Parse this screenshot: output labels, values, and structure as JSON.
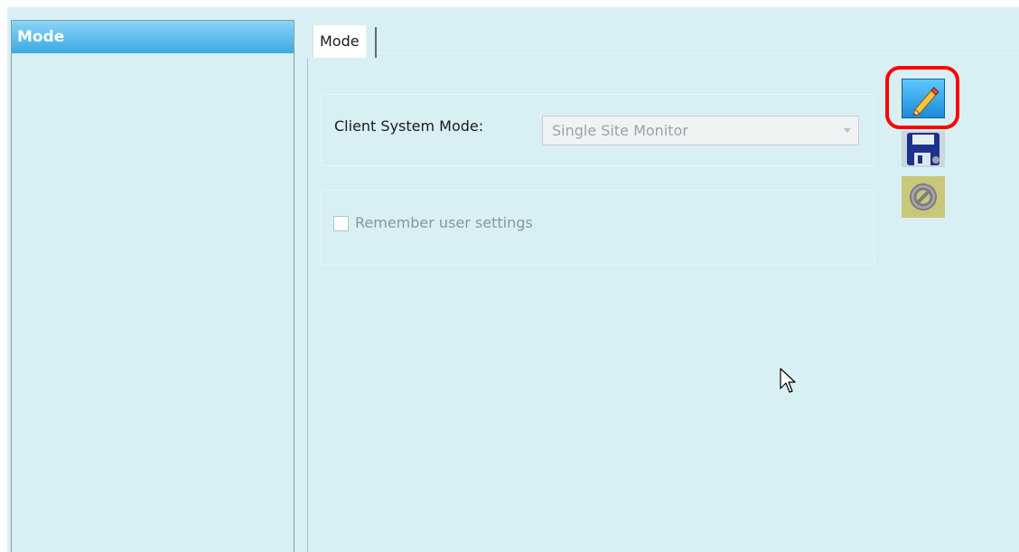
{
  "nav": {
    "items": [
      {
        "label": "Mode",
        "selected": true
      }
    ]
  },
  "tabs": [
    {
      "label": "Mode",
      "active": true
    }
  ],
  "client_system_mode": {
    "label": "Client System Mode:",
    "value": "Single Site Monitor",
    "disabled": true
  },
  "remember_settings": {
    "label": "Remember user settings",
    "checked": false,
    "disabled": true
  },
  "actions": {
    "edit": {
      "icon": "pencil-icon",
      "highlighted": true
    },
    "save": {
      "icon": "floppy-disk-icon"
    },
    "cancel": {
      "icon": "cancel-circle-icon"
    }
  },
  "colors": {
    "background": "#d8f0f3",
    "nav_selected": "#3aa9e4",
    "highlight": "#ff0000"
  }
}
